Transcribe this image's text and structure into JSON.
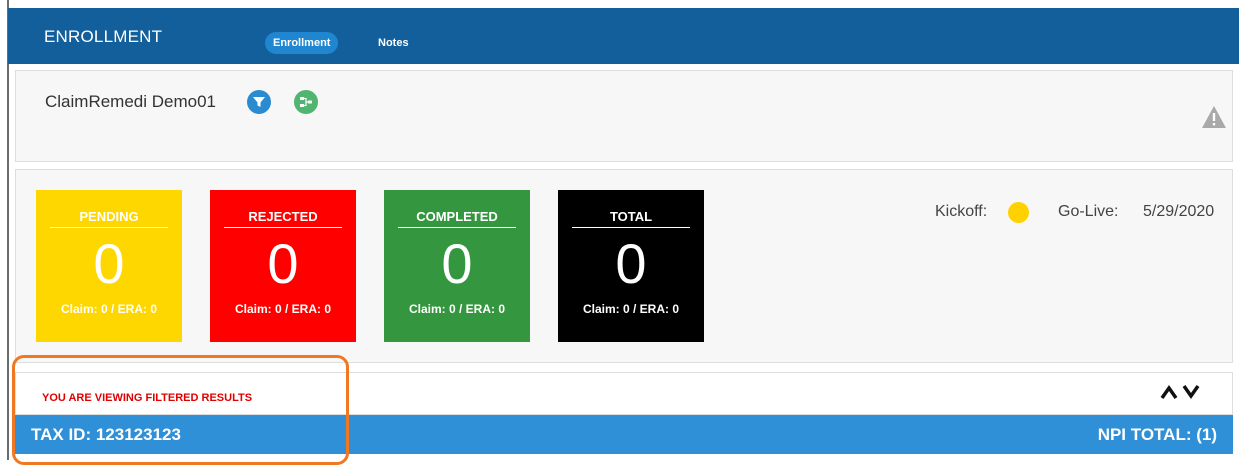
{
  "header": {
    "title": "ENROLLMENT",
    "tabs": [
      {
        "label": "Enrollment",
        "active": true
      },
      {
        "label": "Notes",
        "active": false
      }
    ]
  },
  "organization": {
    "name": "ClaimRemedi Demo01",
    "icons": [
      "filter-icon",
      "hierarchy-icon",
      "warning-icon"
    ]
  },
  "status_tiles": [
    {
      "label": "PENDING",
      "count": "0",
      "sub": "Claim: 0 / ERA: 0",
      "color": "#ffd700"
    },
    {
      "label": "REJECTED",
      "count": "0",
      "sub": "Claim: 0 / ERA: 0",
      "color": "#ff0000"
    },
    {
      "label": "COMPLETED",
      "count": "0",
      "sub": "Claim: 0 / ERA: 0",
      "color": "#34963f"
    },
    {
      "label": "TOTAL",
      "count": "0",
      "sub": "Claim: 0 / ERA: 0",
      "color": "#000000"
    }
  ],
  "milestones": {
    "kickoff_label": "Kickoff:",
    "kickoff_status_color": "#ffd100",
    "golive_label": "Go-Live:",
    "golive_date": "5/29/2020"
  },
  "filter": {
    "message": "YOU ARE VIEWING FILTERED RESULTS",
    "sort_icons": [
      "chevron-up-icon",
      "chevron-down-icon"
    ]
  },
  "tax_row": {
    "tax_id": "TAX ID: 123123123",
    "npi_total": "NPI TOTAL: (1)"
  },
  "colors": {
    "header_bg": "#125f9c",
    "tax_bar_bg": "#2f8fd7",
    "highlight_outline": "#f07822",
    "filter_message": "#e00000"
  }
}
